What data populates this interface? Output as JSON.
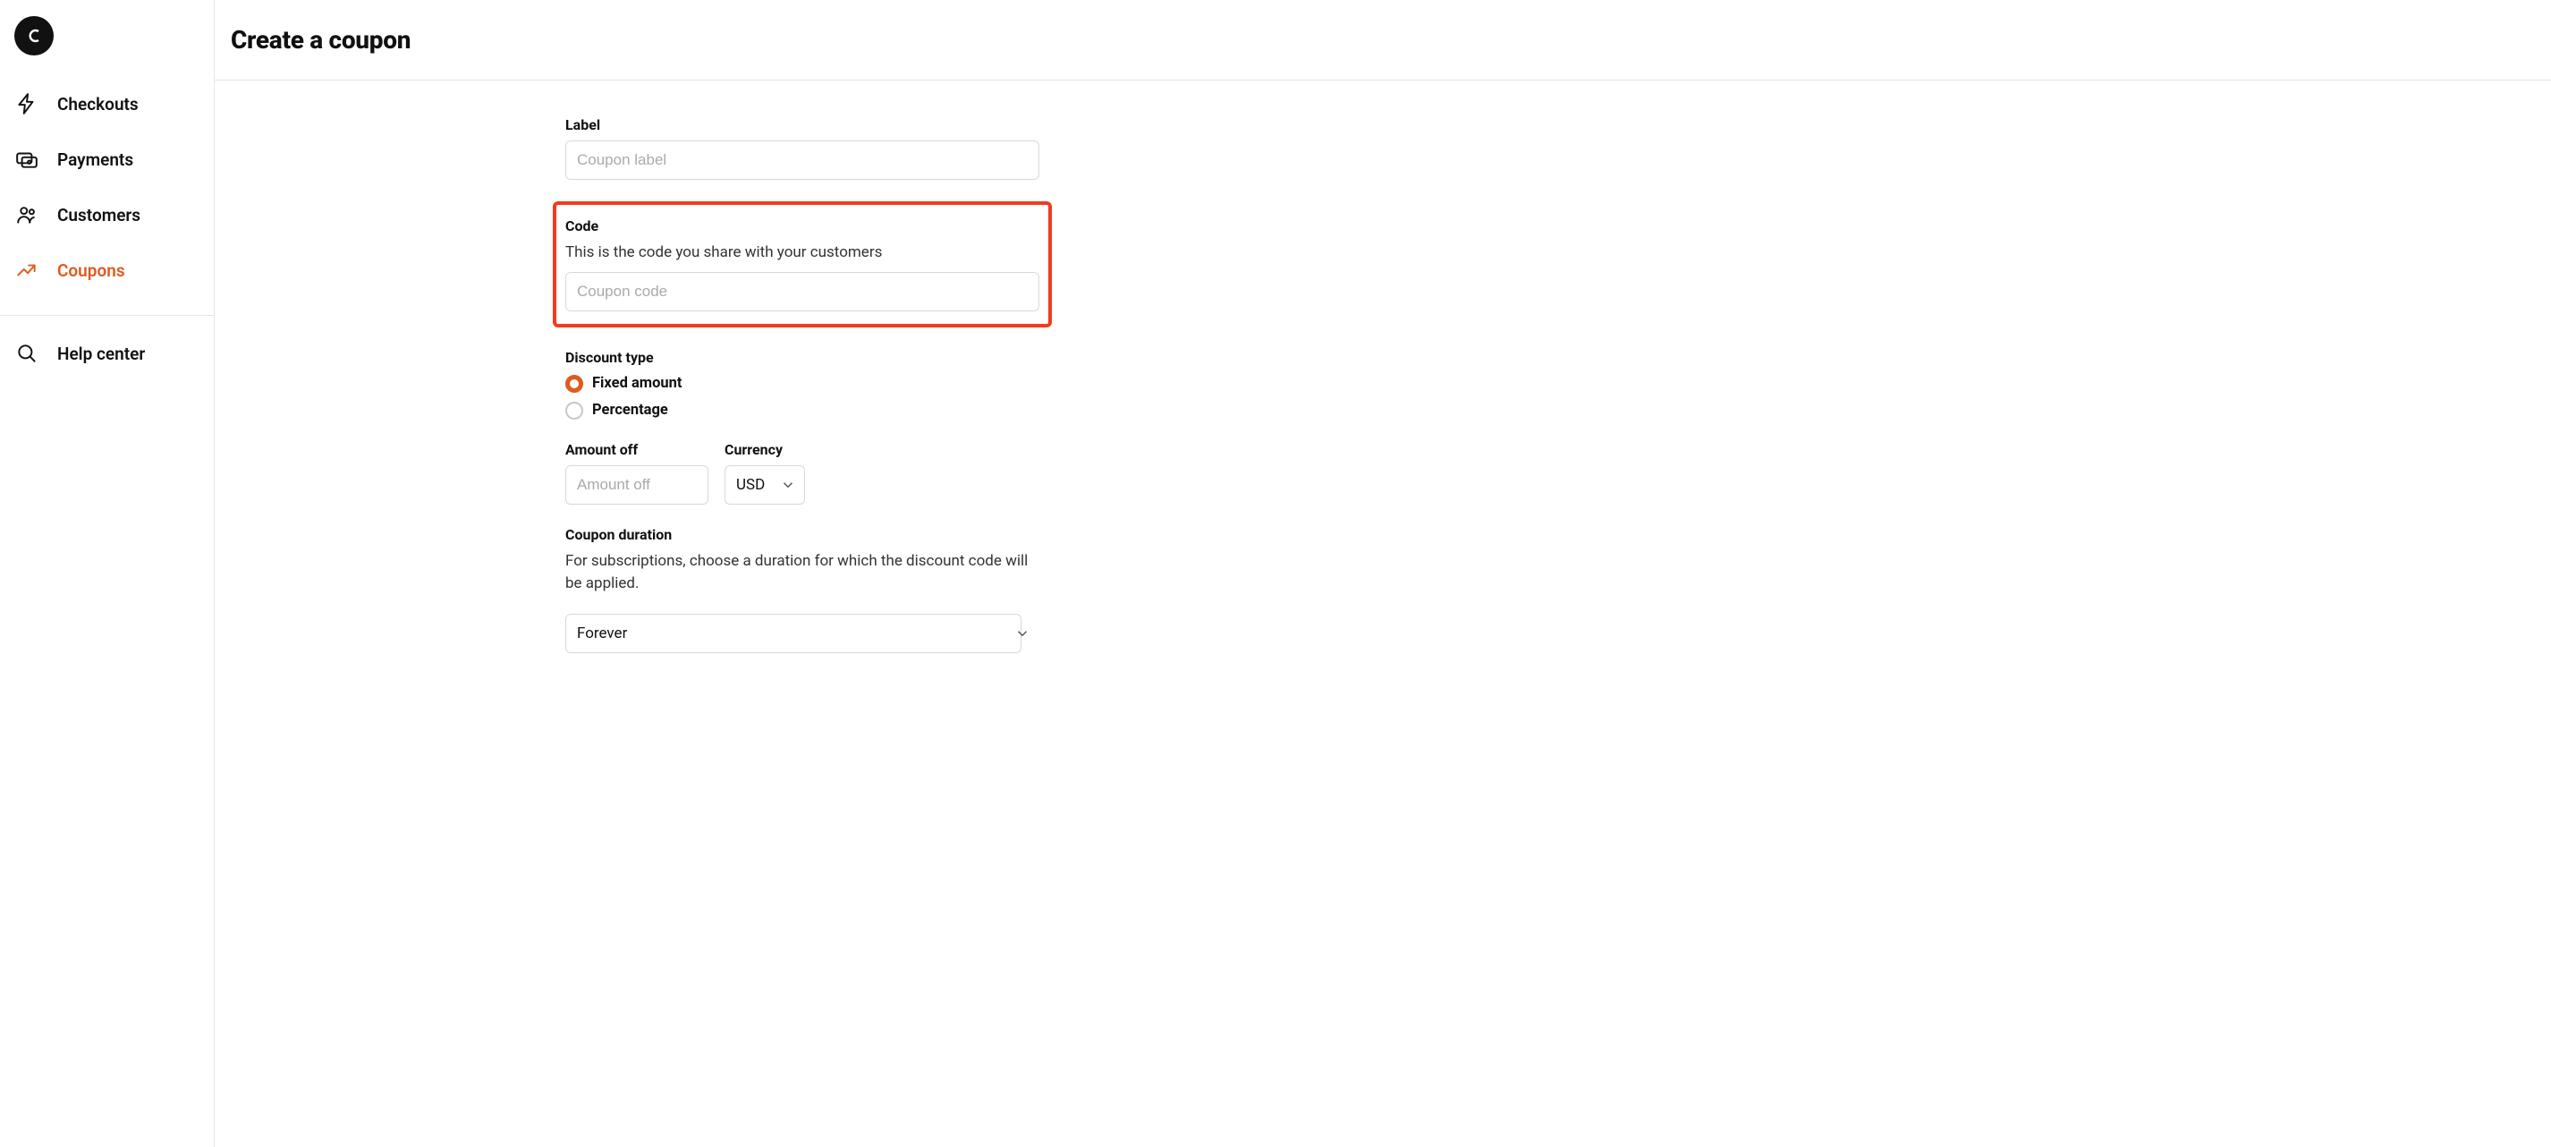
{
  "header": {
    "title": "Create a coupon"
  },
  "sidebar": {
    "items": [
      {
        "label": "Checkouts"
      },
      {
        "label": "Payments"
      },
      {
        "label": "Customers"
      },
      {
        "label": "Coupons"
      }
    ],
    "help": {
      "label": "Help center"
    }
  },
  "form": {
    "label": {
      "title": "Label",
      "placeholder": "Coupon label"
    },
    "code": {
      "title": "Code",
      "help": "This is the code you share with your customers",
      "placeholder": "Coupon code"
    },
    "discount_type": {
      "title": "Discount type",
      "options": [
        {
          "label": "Fixed amount",
          "selected": true
        },
        {
          "label": "Percentage",
          "selected": false
        }
      ]
    },
    "amount_off": {
      "title": "Amount off",
      "placeholder": "Amount off"
    },
    "currency": {
      "title": "Currency",
      "value": "USD"
    },
    "duration": {
      "title": "Coupon duration",
      "help": "For subscriptions, choose a duration for which the discount code will be applied.",
      "value": "Forever"
    }
  }
}
